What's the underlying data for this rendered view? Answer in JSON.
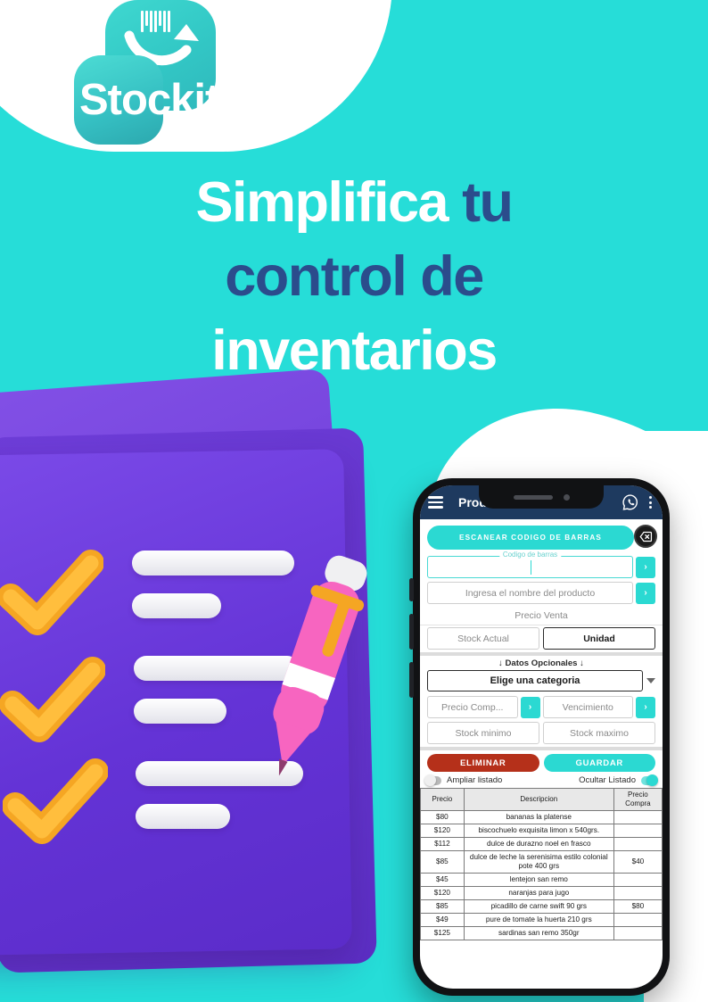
{
  "brand": {
    "name": "Stockit",
    "logo_icon": "barcode-arrow-icon",
    "teal": "#26DDD8",
    "deep_blue": "#2B4C8C",
    "purple": "#6433D6",
    "orange": "#F5A623"
  },
  "headline": {
    "line1_white": "Simplifica ",
    "line1_dark": "tu",
    "line2_dark": "control de",
    "line3_white": "inventarios"
  },
  "illustration": {
    "name": "3d-checklist-folder",
    "checkmarks": 3,
    "pen_color": "#F765C0"
  },
  "phone": {
    "appbar": {
      "menu_icon": "hamburger-icon",
      "title": "Productos",
      "whatsapp_icon": "whatsapp-icon",
      "overflow_icon": "kebab-menu-icon"
    },
    "scan": {
      "button_label": "ESCANEAR CODIGO DE BARRAS",
      "clear_icon": "backspace-delete-icon"
    },
    "fields": {
      "barcode_label": "Codigo de barras",
      "barcode_value": "",
      "barcode_arrow": "›",
      "product_name_placeholder": "Ingresa el nombre del producto",
      "product_arrow": "›",
      "precio_venta": "Precio Venta",
      "stock_actual": "Stock Actual",
      "unidad": "Unidad"
    },
    "optional": {
      "title": "↓ Datos Opcionales ↓",
      "category_value": "Elige una categoria",
      "precio_compra": "Precio Comp...",
      "precio_compra_arrow": "›",
      "vencimiento": "Vencimiento",
      "vencimiento_arrow": "›",
      "stock_minimo": "Stock minimo",
      "stock_maximo": "Stock maximo"
    },
    "actions": {
      "delete_label": "ELIMINAR",
      "save_label": "GUARDAR",
      "delete_color": "#B5301A",
      "save_color": "#2BD9D2"
    },
    "toggles": [
      {
        "label": "Ampliar listado",
        "state": "off"
      },
      {
        "label": "Ocultar Listado",
        "state": "on"
      }
    ],
    "table": {
      "headers": [
        "Precio",
        "Descripcion",
        "Precio Compra"
      ],
      "rows": [
        {
          "precio": "$80",
          "descripcion": "bananas la platense",
          "compra": ""
        },
        {
          "precio": "$120",
          "descripcion": "biscochuelo exquisita limon x 540grs.",
          "compra": ""
        },
        {
          "precio": "$112",
          "descripcion": "dulce de durazno noel en frasco",
          "compra": ""
        },
        {
          "precio": "$85",
          "descripcion": "dulce de leche la serenisima estilo colonial pote 400 grs",
          "compra": "$40"
        },
        {
          "precio": "$45",
          "descripcion": "lentejon san remo",
          "compra": ""
        },
        {
          "precio": "$120",
          "descripcion": "naranjas para jugo",
          "compra": ""
        },
        {
          "precio": "$85",
          "descripcion": "picadillo de carne swift 90 grs",
          "compra": "$80"
        },
        {
          "precio": "$49",
          "descripcion": "pure de tomate la huerta 210 grs",
          "compra": ""
        },
        {
          "precio": "$125",
          "descripcion": "sardinas san remo 350gr",
          "compra": ""
        }
      ]
    }
  }
}
